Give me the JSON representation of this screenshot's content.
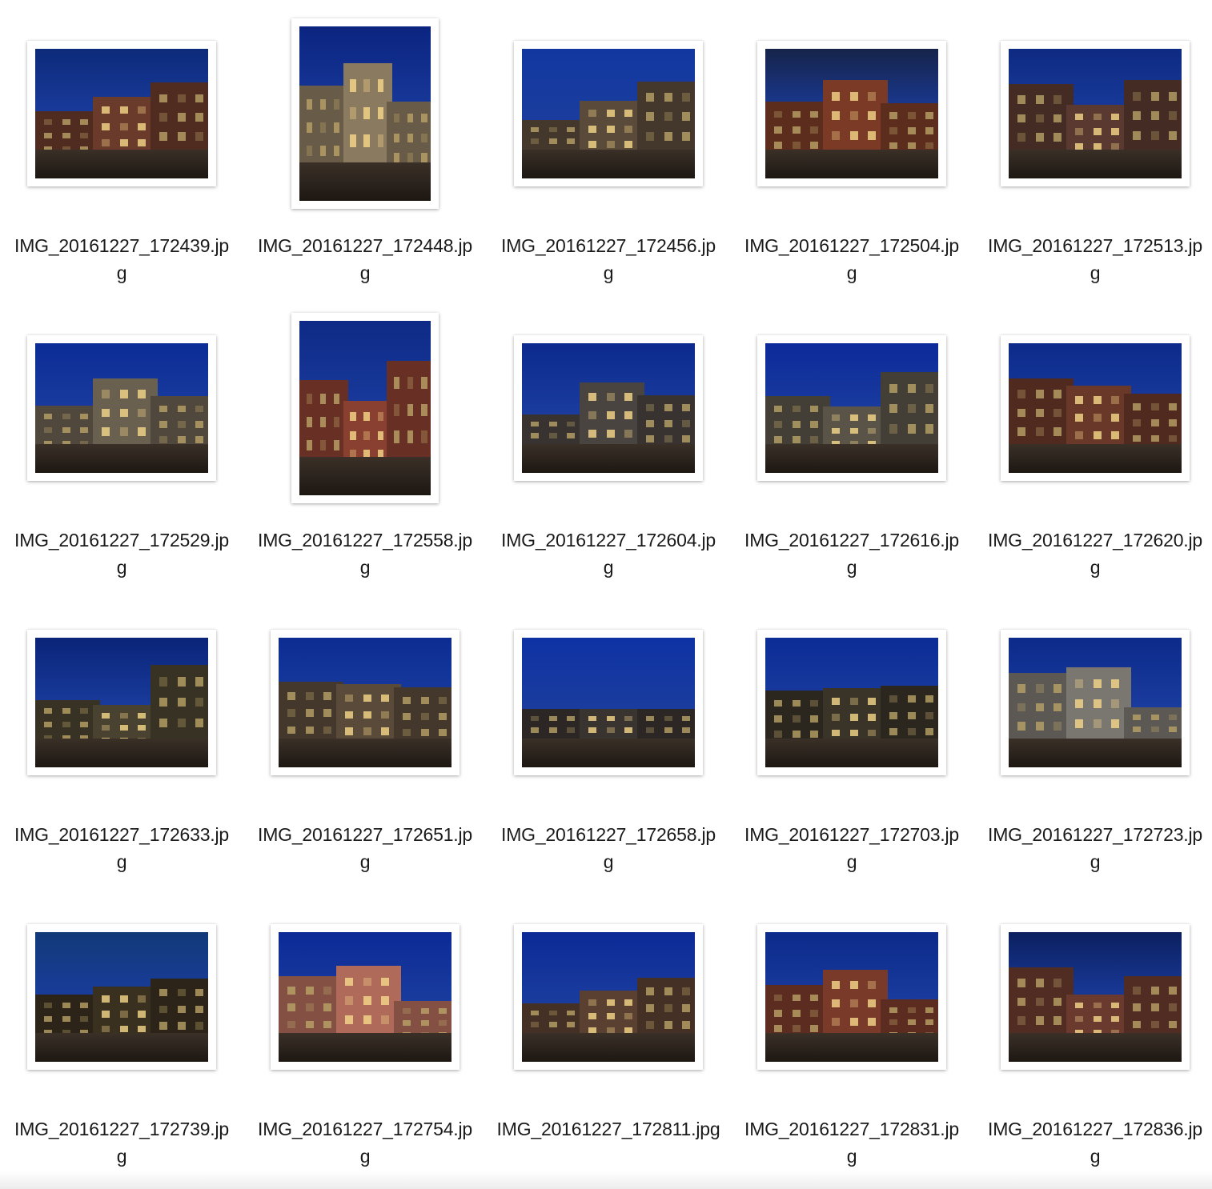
{
  "files": [
    {
      "line1": "IMG_20161227_172439.jp",
      "line2": "g",
      "orientation": "landscape",
      "sky": "#0d2a7a",
      "building": "#6a3a2a"
    },
    {
      "line1": "IMG_20161227_172448.jp",
      "line2": "g",
      "orientation": "portrait",
      "sky": "#0b2480",
      "building": "#8a7a60"
    },
    {
      "line1": "IMG_20161227_172456.jp",
      "line2": "g",
      "orientation": "landscape",
      "sky": "#1238a0",
      "building": "#5a4a3a"
    },
    {
      "line1": "IMG_20161227_172504.jp",
      "line2": "g",
      "orientation": "landscape",
      "sky": "#16244a",
      "building": "#7a3a26"
    },
    {
      "line1": "IMG_20161227_172513.jp",
      "line2": "g",
      "orientation": "landscape",
      "sky": "#0e2a82",
      "building": "#5a3a30"
    },
    {
      "line1": "IMG_20161227_172529.jp",
      "line2": "g",
      "orientation": "landscape",
      "sky": "#0c2c96",
      "building": "#6a6050"
    },
    {
      "line1": "IMG_20161227_172558.jp",
      "line2": "g",
      "orientation": "portrait",
      "sky": "#0e2a86",
      "building": "#8a4030"
    },
    {
      "line1": "IMG_20161227_172604.jp",
      "line2": "g",
      "orientation": "landscape",
      "sky": "#0c2a8e",
      "building": "#4a4440"
    },
    {
      "line1": "IMG_20161227_172616.jp",
      "line2": "g",
      "orientation": "landscape",
      "sky": "#0c2a9a",
      "building": "#5a5448"
    },
    {
      "line1": "IMG_20161227_172620.jp",
      "line2": "g",
      "orientation": "landscape",
      "sky": "#0c2a8a",
      "building": "#6a3828"
    },
    {
      "line1": "IMG_20161227_172633.jp",
      "line2": "g",
      "orientation": "landscape",
      "sky": "#0a2478",
      "building": "#4a4230"
    },
    {
      "line1": "IMG_20161227_172651.jp",
      "line2": "g",
      "orientation": "landscape",
      "sky": "#0c2c92",
      "building": "#5a4a3a"
    },
    {
      "line1": "IMG_20161227_172658.jp",
      "line2": "g",
      "orientation": "landscape",
      "sky": "#0e32a4",
      "building": "#3a3430"
    },
    {
      "line1": "IMG_20161227_172703.jp",
      "line2": "g",
      "orientation": "landscape",
      "sky": "#0c2c96",
      "building": "#3a3428"
    },
    {
      "line1": "IMG_20161227_172723.jp",
      "line2": "g",
      "orientation": "landscape",
      "sky": "#0c2a8a",
      "building": "#7a7670"
    },
    {
      "line1": "IMG_20161227_172739.jp",
      "line2": "g",
      "orientation": "landscape",
      "sky": "#123a78",
      "building": "#3a3020"
    },
    {
      "line1": "IMG_20161227_172754.jp",
      "line2": "g",
      "orientation": "landscape",
      "sky": "#0c2a96",
      "building": "#b06a5a"
    },
    {
      "line1": "IMG_20161227_172811.jpg",
      "line2": "",
      "orientation": "landscape",
      "sky": "#0c2a96",
      "building": "#5a4030"
    },
    {
      "line1": "IMG_20161227_172831.jp",
      "line2": "g",
      "orientation": "landscape",
      "sky": "#0c2a8a",
      "building": "#7a3a2a"
    },
    {
      "line1": "IMG_20161227_172836.jp",
      "line2": "g",
      "orientation": "landscape",
      "sky": "#0c2060",
      "building": "#6a3a2e"
    }
  ]
}
